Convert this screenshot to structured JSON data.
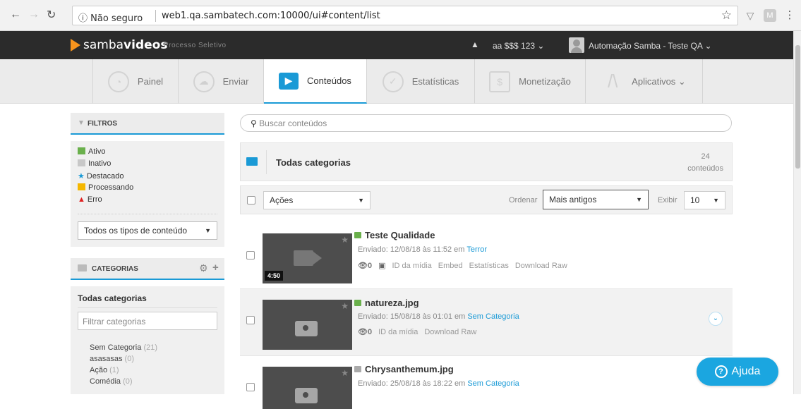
{
  "browser": {
    "security_label": "ⓘ Não seguro",
    "url": "web1.qa.sambatech.com:10000/ui#content/list"
  },
  "header": {
    "logo_plain": "samba",
    "logo_bold": "videos",
    "subtitle": "Processo Seletivo",
    "account": "aa $$$ 123 ⌄",
    "user": "Automação Samba - Teste QA ⌄"
  },
  "tabs": [
    {
      "label": "Painel",
      "icon": "dashboard-icon"
    },
    {
      "label": "Enviar",
      "icon": "upload-cloud-icon"
    },
    {
      "label": "Conteúdos",
      "icon": "play-icon"
    },
    {
      "label": "Estatísticas",
      "icon": "stats-icon"
    },
    {
      "label": "Monetização",
      "icon": "money-icon"
    },
    {
      "label": "Aplicativos ⌄",
      "icon": "apps-icon"
    }
  ],
  "filters": {
    "title": "FILTROS",
    "legend": [
      {
        "label": "Ativo",
        "color": "#6ab04c"
      },
      {
        "label": "Inativo",
        "color": "#c8c8c8"
      },
      {
        "label": "Destacado",
        "color": "#1a9ad6"
      },
      {
        "label": "Processando",
        "color": "#f5b700"
      },
      {
        "label": "Erro",
        "color": "#e02020"
      }
    ],
    "type_select": "Todos os tipos de conteúdo"
  },
  "categories": {
    "title": "CATEGORIAS",
    "all_label": "Todas categorias",
    "filter_placeholder": "Filtrar categorias",
    "items": [
      {
        "name": "Sem Categoria",
        "count": "(21)"
      },
      {
        "name": "asasasas",
        "count": "(0)"
      },
      {
        "name": "Ação",
        "count": "(1)"
      },
      {
        "name": "Comédia",
        "count": "(0)"
      }
    ]
  },
  "search": {
    "placeholder": "Buscar conteúdos"
  },
  "category_bar": {
    "name": "Todas categorias",
    "count": "24",
    "count_label": "conteúdos"
  },
  "actions_bar": {
    "actions": "Ações",
    "sort_label": "Ordenar",
    "sort_value": "Mais antigos",
    "show_label": "Exibir",
    "show_value": "10"
  },
  "items": [
    {
      "title": "Teste Qualidade",
      "uploaded": "Enviado: 12/08/18 às 11:52 em ",
      "category": "Terror",
      "views": "0",
      "duration": "4:50",
      "links": [
        "ID da mídia",
        "Embed",
        "Estatísticas",
        "Download Raw"
      ]
    },
    {
      "title": "natureza.jpg",
      "uploaded": "Enviado: 15/08/18 às 01:01 em ",
      "category": "Sem Categoria",
      "views": "0",
      "links": [
        "ID da mídia",
        "Download Raw"
      ]
    },
    {
      "title": "Chrysanthemum.jpg",
      "uploaded": "Enviado: 25/08/18 às 18:22 em ",
      "category": "Sem Categoria"
    }
  ],
  "help": {
    "label": "Ajuda"
  },
  "colors": {
    "accent": "#1a9ad6",
    "header": "#2b2b2b",
    "logo": "#f7941d",
    "help": "#1ba6e0"
  }
}
